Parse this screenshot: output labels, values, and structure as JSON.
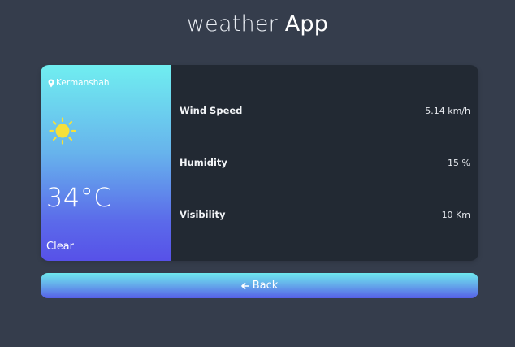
{
  "header": {
    "title_light": "weather",
    "title_bold": "App"
  },
  "weather": {
    "location": "Kermanshah",
    "icon": "sun-icon",
    "temperature": "34°C",
    "condition": "Clear"
  },
  "details": [
    {
      "label": "Wind Speed",
      "value": "5.14 km/h"
    },
    {
      "label": "Humidity",
      "value": "15 %"
    },
    {
      "label": "Visibility",
      "value": "10 Km"
    }
  ],
  "actions": {
    "back_label": "Back"
  },
  "colors": {
    "page_background": "#353d4c",
    "card_background": "#222933",
    "gradient_top": "#70eef0",
    "gradient_bottom": "#5751e8",
    "sun": "#f5e03a"
  }
}
